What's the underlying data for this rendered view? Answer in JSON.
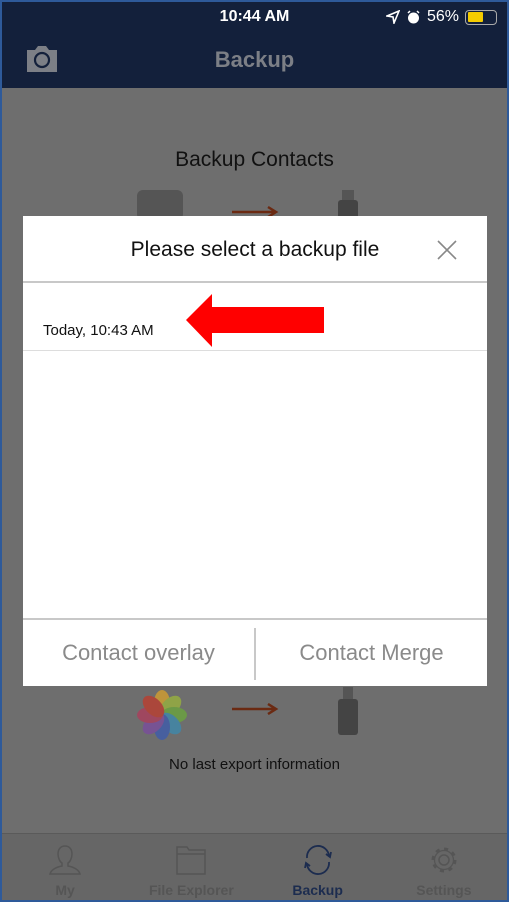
{
  "status_bar": {
    "time": "10:44 AM",
    "battery": "56%",
    "battery_level": 0.56,
    "icons": [
      "location-icon",
      "alarm-icon",
      "battery-icon"
    ]
  },
  "nav": {
    "title": "Backup",
    "left_icon": "camera-icon"
  },
  "main": {
    "section_title": "Backup Contacts",
    "export_info": "No last export information"
  },
  "dialog": {
    "title": "Please select a backup file",
    "items": [
      {
        "label": "Today, 10:43 AM"
      }
    ],
    "buttons": {
      "overlay": "Contact overlay",
      "merge": "Contact Merge"
    }
  },
  "annotation": {
    "color": "#ff0000",
    "icon": "red-arrow-left"
  },
  "tabs": [
    {
      "label": "My",
      "icon": "person-icon"
    },
    {
      "label": "File Explorer",
      "icon": "folder-icon"
    },
    {
      "label": "Backup",
      "icon": "sync-icon",
      "active": true
    },
    {
      "label": "Settings",
      "icon": "gear-icon"
    }
  ]
}
